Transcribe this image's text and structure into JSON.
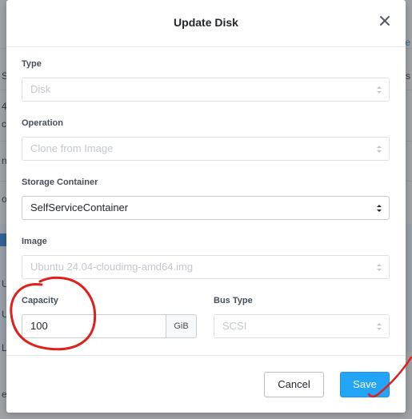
{
  "background": {
    "left_fragments": [
      "Su",
      "4",
      "ch",
      "nt",
      "o",
      "U",
      "U",
      "L",
      "e"
    ],
    "right_fragments": [
      "ne",
      "s"
    ]
  },
  "modal": {
    "title": "Update Disk",
    "fields": {
      "type": {
        "label": "Type",
        "value": "Disk",
        "disabled": true
      },
      "operation": {
        "label": "Operation",
        "value": "Clone from Image",
        "disabled": true
      },
      "storage_container": {
        "label": "Storage Container",
        "value": "SelfServiceContainer",
        "disabled": false
      },
      "image": {
        "label": "Image",
        "value": "Ubuntu 24.04-cloudimg-amd64.img",
        "disabled": true
      },
      "capacity": {
        "label": "Capacity",
        "value": "100",
        "unit": "GiB"
      },
      "bus_type": {
        "label": "Bus Type",
        "value": "SCSI",
        "disabled": true
      }
    },
    "buttons": {
      "cancel": "Cancel",
      "save": "Save"
    }
  },
  "icons": {
    "close": "close-icon",
    "select_caret": "sort-caret-icon"
  },
  "colors": {
    "primary": "#22a5f7",
    "annotation": "#e0201b",
    "disabled_text": "#c3c8cf"
  }
}
